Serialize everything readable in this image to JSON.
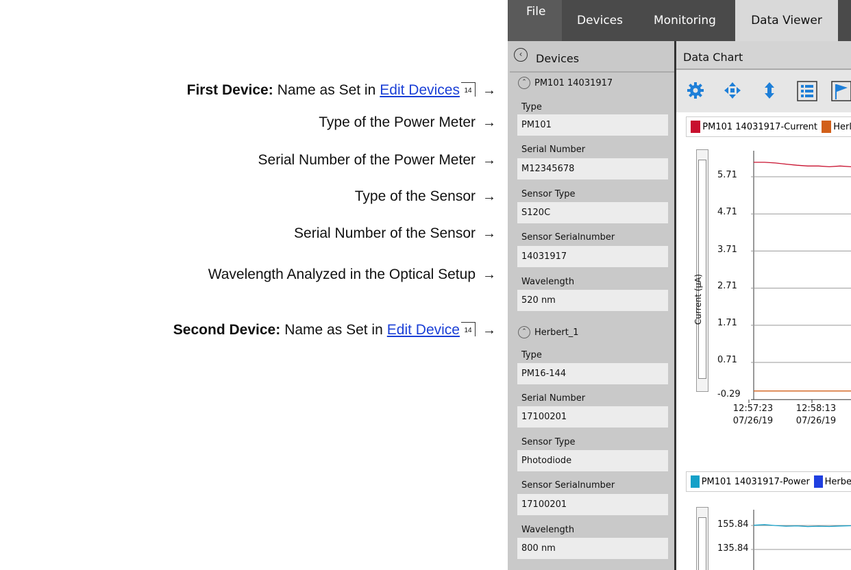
{
  "annotations": [
    {
      "bold": "First Device:",
      "text": "Name as Set in",
      "link": "Edit Devices",
      "page": "14"
    },
    {
      "bold": "",
      "text": "Type of the Power Meter",
      "link": "",
      "page": ""
    },
    {
      "bold": "",
      "text": "Serial Number of the Power Meter",
      "link": "",
      "page": ""
    },
    {
      "bold": "",
      "text": "Type of the Sensor",
      "link": "",
      "page": ""
    },
    {
      "bold": "",
      "text": "Serial Number of the Sensor",
      "link": "",
      "page": ""
    },
    {
      "bold": "",
      "text": "Wavelength Analyzed in the Optical Setup",
      "link": "",
      "page": ""
    },
    {
      "bold": "Second Device:",
      "text": "Name as Set in",
      "link": "Edit Device",
      "page": "14"
    }
  ],
  "arrow": "→",
  "menu": {
    "file": "File",
    "devices": "Devices",
    "monitoring": "Monitoring",
    "data_viewer": "Data Viewer"
  },
  "sidebar": {
    "title": "Devices",
    "devices": [
      {
        "name": "PM101 14031917",
        "fields": [
          {
            "label": "Type",
            "value": "PM101"
          },
          {
            "label": "Serial Number",
            "value": "M12345678"
          },
          {
            "label": "Sensor Type",
            "value": "S120C"
          },
          {
            "label": "Sensor Serialnumber",
            "value": "14031917"
          },
          {
            "label": "Wavelength",
            "value": "520 nm"
          }
        ]
      },
      {
        "name": "Herbert_1",
        "fields": [
          {
            "label": "Type",
            "value": "PM16-144"
          },
          {
            "label": "Serial Number",
            "value": "17100201"
          },
          {
            "label": "Sensor Type",
            "value": "Photodiode"
          },
          {
            "label": "Sensor Serialnumber",
            "value": "17100201"
          },
          {
            "label": "Wavelength",
            "value": "800 nm"
          }
        ]
      }
    ]
  },
  "main": {
    "title": "Data Chart"
  },
  "colors": {
    "pm101_current": "#c8102e",
    "herbert_current": "#d2601a",
    "pm101_power": "#14a0c8",
    "herbert_power": "#1f3fe0",
    "toolbar_icon": "#1e7fd8"
  },
  "chart_data": [
    {
      "type": "line",
      "ylabel": "Current (µA)",
      "yticks": [
        "5.71",
        "4.71",
        "3.71",
        "2.71",
        "1.71",
        "0.71",
        "-0.29"
      ],
      "xticks": [
        {
          "time": "12:57:23",
          "date": "07/26/19"
        },
        {
          "time": "12:58:13",
          "date": "07/26/19"
        }
      ],
      "series": [
        {
          "name": "PM101 14031917-Current",
          "values": [
            6.1,
            6.1,
            6.08,
            6.05,
            6.02,
            6.0,
            6.0,
            5.98,
            6.0,
            5.98
          ]
        },
        {
          "name": "Herl",
          "values": [
            -0.06,
            -0.06,
            -0.06,
            -0.06,
            -0.06,
            -0.06,
            -0.06,
            -0.06,
            -0.06,
            -0.06
          ]
        }
      ]
    },
    {
      "type": "line",
      "yticks": [
        "155.84",
        "135.84"
      ],
      "series": [
        {
          "name": "PM101 14031917-Power",
          "values": [
            156.0,
            156.5,
            155.8,
            155.2,
            155.5,
            154.9,
            155.2,
            155.0,
            155.4,
            155.6
          ]
        },
        {
          "name": "Herbe",
          "values": []
        }
      ]
    }
  ]
}
